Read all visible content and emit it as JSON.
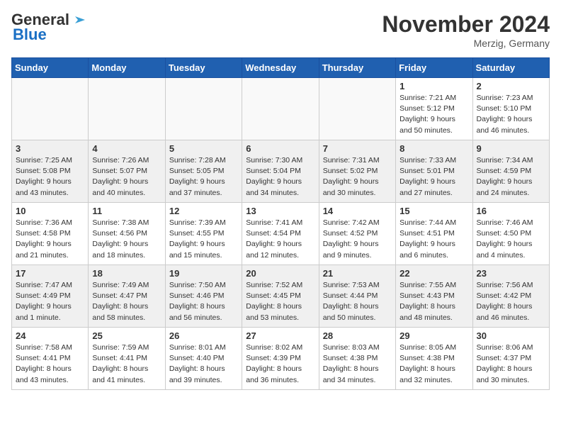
{
  "logo": {
    "line1": "General",
    "line2": "Blue"
  },
  "title": "November 2024",
  "location": "Merzig, Germany",
  "days_of_week": [
    "Sunday",
    "Monday",
    "Tuesday",
    "Wednesday",
    "Thursday",
    "Friday",
    "Saturday"
  ],
  "weeks": [
    [
      {
        "num": "",
        "info": "",
        "empty": true
      },
      {
        "num": "",
        "info": "",
        "empty": true
      },
      {
        "num": "",
        "info": "",
        "empty": true
      },
      {
        "num": "",
        "info": "",
        "empty": true
      },
      {
        "num": "",
        "info": "",
        "empty": true
      },
      {
        "num": "1",
        "info": "Sunrise: 7:21 AM\nSunset: 5:12 PM\nDaylight: 9 hours\nand 50 minutes.",
        "empty": false
      },
      {
        "num": "2",
        "info": "Sunrise: 7:23 AM\nSunset: 5:10 PM\nDaylight: 9 hours\nand 46 minutes.",
        "empty": false
      }
    ],
    [
      {
        "num": "3",
        "info": "Sunrise: 7:25 AM\nSunset: 5:08 PM\nDaylight: 9 hours\nand 43 minutes.",
        "empty": false
      },
      {
        "num": "4",
        "info": "Sunrise: 7:26 AM\nSunset: 5:07 PM\nDaylight: 9 hours\nand 40 minutes.",
        "empty": false
      },
      {
        "num": "5",
        "info": "Sunrise: 7:28 AM\nSunset: 5:05 PM\nDaylight: 9 hours\nand 37 minutes.",
        "empty": false
      },
      {
        "num": "6",
        "info": "Sunrise: 7:30 AM\nSunset: 5:04 PM\nDaylight: 9 hours\nand 34 minutes.",
        "empty": false
      },
      {
        "num": "7",
        "info": "Sunrise: 7:31 AM\nSunset: 5:02 PM\nDaylight: 9 hours\nand 30 minutes.",
        "empty": false
      },
      {
        "num": "8",
        "info": "Sunrise: 7:33 AM\nSunset: 5:01 PM\nDaylight: 9 hours\nand 27 minutes.",
        "empty": false
      },
      {
        "num": "9",
        "info": "Sunrise: 7:34 AM\nSunset: 4:59 PM\nDaylight: 9 hours\nand 24 minutes.",
        "empty": false
      }
    ],
    [
      {
        "num": "10",
        "info": "Sunrise: 7:36 AM\nSunset: 4:58 PM\nDaylight: 9 hours\nand 21 minutes.",
        "empty": false
      },
      {
        "num": "11",
        "info": "Sunrise: 7:38 AM\nSunset: 4:56 PM\nDaylight: 9 hours\nand 18 minutes.",
        "empty": false
      },
      {
        "num": "12",
        "info": "Sunrise: 7:39 AM\nSunset: 4:55 PM\nDaylight: 9 hours\nand 15 minutes.",
        "empty": false
      },
      {
        "num": "13",
        "info": "Sunrise: 7:41 AM\nSunset: 4:54 PM\nDaylight: 9 hours\nand 12 minutes.",
        "empty": false
      },
      {
        "num": "14",
        "info": "Sunrise: 7:42 AM\nSunset: 4:52 PM\nDaylight: 9 hours\nand 9 minutes.",
        "empty": false
      },
      {
        "num": "15",
        "info": "Sunrise: 7:44 AM\nSunset: 4:51 PM\nDaylight: 9 hours\nand 6 minutes.",
        "empty": false
      },
      {
        "num": "16",
        "info": "Sunrise: 7:46 AM\nSunset: 4:50 PM\nDaylight: 9 hours\nand 4 minutes.",
        "empty": false
      }
    ],
    [
      {
        "num": "17",
        "info": "Sunrise: 7:47 AM\nSunset: 4:49 PM\nDaylight: 9 hours\nand 1 minute.",
        "empty": false
      },
      {
        "num": "18",
        "info": "Sunrise: 7:49 AM\nSunset: 4:47 PM\nDaylight: 8 hours\nand 58 minutes.",
        "empty": false
      },
      {
        "num": "19",
        "info": "Sunrise: 7:50 AM\nSunset: 4:46 PM\nDaylight: 8 hours\nand 56 minutes.",
        "empty": false
      },
      {
        "num": "20",
        "info": "Sunrise: 7:52 AM\nSunset: 4:45 PM\nDaylight: 8 hours\nand 53 minutes.",
        "empty": false
      },
      {
        "num": "21",
        "info": "Sunrise: 7:53 AM\nSunset: 4:44 PM\nDaylight: 8 hours\nand 50 minutes.",
        "empty": false
      },
      {
        "num": "22",
        "info": "Sunrise: 7:55 AM\nSunset: 4:43 PM\nDaylight: 8 hours\nand 48 minutes.",
        "empty": false
      },
      {
        "num": "23",
        "info": "Sunrise: 7:56 AM\nSunset: 4:42 PM\nDaylight: 8 hours\nand 46 minutes.",
        "empty": false
      }
    ],
    [
      {
        "num": "24",
        "info": "Sunrise: 7:58 AM\nSunset: 4:41 PM\nDaylight: 8 hours\nand 43 minutes.",
        "empty": false
      },
      {
        "num": "25",
        "info": "Sunrise: 7:59 AM\nSunset: 4:41 PM\nDaylight: 8 hours\nand 41 minutes.",
        "empty": false
      },
      {
        "num": "26",
        "info": "Sunrise: 8:01 AM\nSunset: 4:40 PM\nDaylight: 8 hours\nand 39 minutes.",
        "empty": false
      },
      {
        "num": "27",
        "info": "Sunrise: 8:02 AM\nSunset: 4:39 PM\nDaylight: 8 hours\nand 36 minutes.",
        "empty": false
      },
      {
        "num": "28",
        "info": "Sunrise: 8:03 AM\nSunset: 4:38 PM\nDaylight: 8 hours\nand 34 minutes.",
        "empty": false
      },
      {
        "num": "29",
        "info": "Sunrise: 8:05 AM\nSunset: 4:38 PM\nDaylight: 8 hours\nand 32 minutes.",
        "empty": false
      },
      {
        "num": "30",
        "info": "Sunrise: 8:06 AM\nSunset: 4:37 PM\nDaylight: 8 hours\nand 30 minutes.",
        "empty": false
      }
    ]
  ]
}
